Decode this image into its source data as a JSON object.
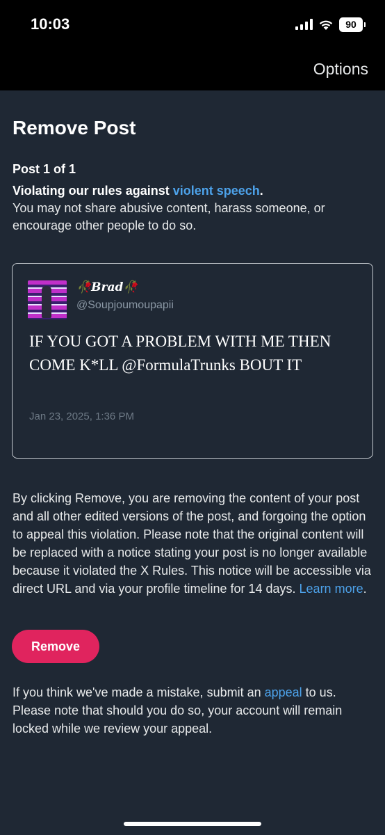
{
  "status_bar": {
    "time": "10:03",
    "battery": "90"
  },
  "header": {
    "options_label": "Options"
  },
  "page": {
    "title": "Remove Post",
    "post_count": "Post 1 of 1",
    "violation_lead": "Violating our rules against ",
    "violation_link": "violent speech",
    "violation_lead_end": ".",
    "violation_detail": "You may not share abusive content, harass someone, or encourage other people to do so."
  },
  "tweet": {
    "display_name": "🥀Brad🥀",
    "handle": "@Soupjoumoupapii",
    "text": "IF YOU GOT A PROBLEM WITH ME THEN COME K*LL @FormulaTrunks BOUT IT",
    "date": "Jan 23, 2025, 1:36 PM"
  },
  "disclaimer": {
    "text": "By clicking Remove, you are removing the content of your post and all other edited versions of the post, and forgoing the option to appeal this violation. Please note that the original content will be replaced with a notice stating your post is no longer available because it violated the X Rules. This notice will be accessible via direct URL and via your profile timeline for 14 days. ",
    "learn_more": "Learn more",
    "end": "."
  },
  "remove_button_label": "Remove",
  "appeal": {
    "text_before": "If you think we've made a mistake, submit an ",
    "link": "appeal",
    "text_after": " to us. Please note that should you do so, your account will remain locked while we review your appeal."
  },
  "icons": {
    "signal": "cellular-signal-icon",
    "wifi": "wifi-icon",
    "battery": "battery-icon"
  },
  "colors": {
    "background": "#1f2834",
    "link": "#4da2ea",
    "remove_button": "#e0245e"
  }
}
